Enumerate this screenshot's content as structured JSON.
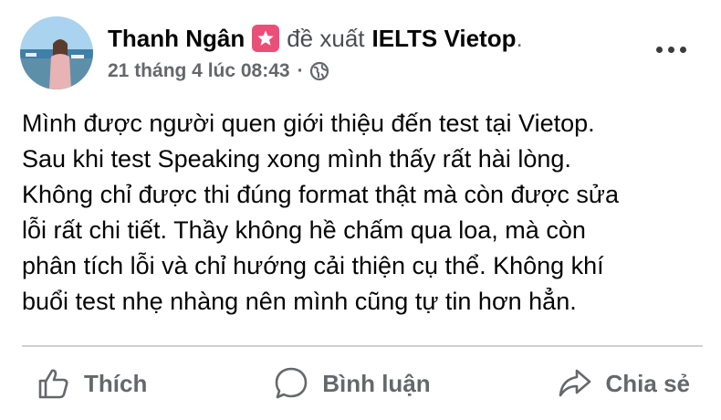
{
  "post": {
    "author": "Thanh Ngân",
    "verb": "đề xuất",
    "page": "IELTS Vietop",
    "page_suffix": ".",
    "timestamp": "21 tháng 4 lúc 08:43",
    "meta_separator": "·",
    "privacy_icon": "globe-icon",
    "badge_icon": "star-badge-icon",
    "text_lines": [
      "Mình được người quen giới thiệu đến test tại Vietop.",
      "Sau khi test Speaking xong mình thấy rất hài lòng.",
      "Không chỉ được thi đúng format thật mà còn được sửa",
      "lỗi rất chi tiết. Thầy không hề chấm qua loa, mà còn",
      "phân tích lỗi và chỉ hướng cải thiện cụ thể. Không khí",
      "buổi test nhẹ nhàng nên mình cũng tự tin hơn hẳn."
    ]
  },
  "actions": {
    "like": "Thích",
    "comment": "Bình luận",
    "share": "Chia sẻ"
  },
  "colors": {
    "text_primary": "#050505",
    "text_secondary": "#65676b",
    "badge": "#ea4f78",
    "divider": "#ced0d4"
  }
}
